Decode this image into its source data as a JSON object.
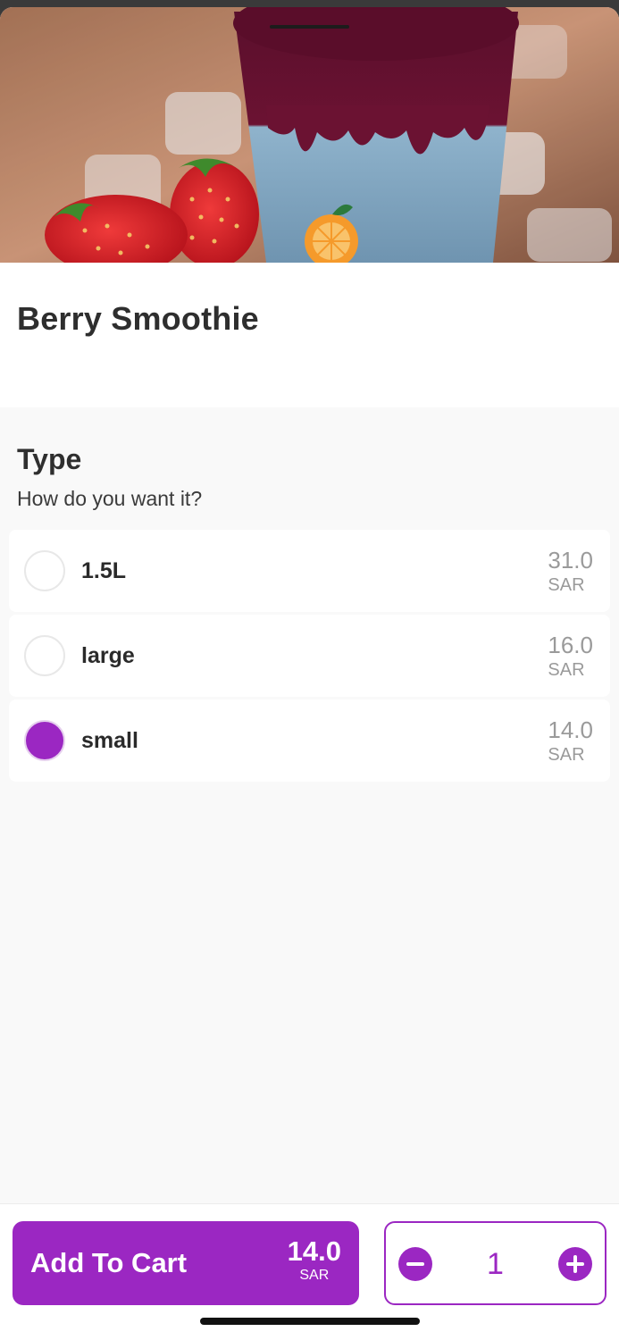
{
  "product": {
    "title": "Berry Smoothie",
    "image_icon": "product-photo"
  },
  "type_section": {
    "title": "Type",
    "subtitle": "How do you want it?",
    "options": [
      {
        "label": "1.5L",
        "price": "31.0",
        "currency": "SAR",
        "selected": false
      },
      {
        "label": "large",
        "price": "16.0",
        "currency": "SAR",
        "selected": false
      },
      {
        "label": "small",
        "price": "14.0",
        "currency": "SAR",
        "selected": true
      }
    ]
  },
  "cart": {
    "add_label": "Add To Cart",
    "total": "14.0",
    "currency": "SAR",
    "quantity": "1",
    "decrement_icon": "minus-icon",
    "increment_icon": "plus-icon"
  },
  "colors": {
    "accent": "#9b27c2",
    "muted_price": "#9a9a9a",
    "background": "#f9f9f9"
  }
}
